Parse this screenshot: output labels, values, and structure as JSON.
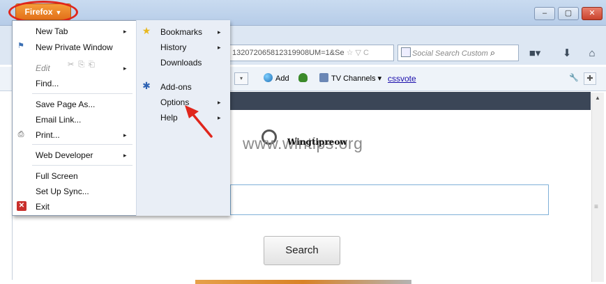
{
  "window": {
    "menu_button": "Firefox",
    "controls": {
      "minimize": "–",
      "maximize": "▢",
      "close": "✕"
    }
  },
  "navbar": {
    "url_fragment": "132072065812319908UM=1&Se",
    "url_icons": "☆ ▽ C",
    "search_placeholder": "Social Search Custom",
    "search_icon_glyph": "⌕",
    "toolbar_icons": [
      "■▾",
      "⬇",
      "⌂"
    ]
  },
  "bookmarks_bar": {
    "dropdown": "▾",
    "add": "Add",
    "tv_channels": "TV Channels ▾",
    "cssvote": "cssvote",
    "right_tools": [
      "🔧",
      "✚"
    ]
  },
  "content": {
    "logo_text": "www.wintips.org",
    "logo_overlay": "Wingtipreow",
    "search_button": "Search"
  },
  "menu": {
    "left": [
      {
        "label": "New Tab",
        "submenu": true
      },
      {
        "label": "New Private Window",
        "submenu": false
      },
      {
        "label": "Edit",
        "submenu": true
      },
      {
        "label": "Find...",
        "submenu": false
      },
      {
        "label": "Save Page As...",
        "submenu": false
      },
      {
        "label": "Email Link...",
        "submenu": false
      },
      {
        "label": "Print...",
        "submenu": true
      },
      {
        "label": "Web Developer",
        "submenu": true
      },
      {
        "label": "Full Screen",
        "submenu": false
      },
      {
        "label": "Set Up Sync...",
        "submenu": false
      },
      {
        "label": "Exit",
        "submenu": false
      }
    ],
    "right": [
      {
        "label": "Bookmarks",
        "submenu": true
      },
      {
        "label": "History",
        "submenu": true
      },
      {
        "label": "Downloads",
        "submenu": false
      },
      {
        "label": "Add-ons",
        "submenu": false
      },
      {
        "label": "Options",
        "submenu": true
      },
      {
        "label": "Help",
        "submenu": true
      }
    ],
    "submenu_glyph": "▸",
    "icons": {
      "bookmarks": "★",
      "private": "⚑",
      "print": "⎙",
      "addons": "✱",
      "exit": "✕",
      "edit_tools": "✂⎘⎗"
    }
  },
  "colors": {
    "firefox_button": "#e2701a",
    "annotation_red": "#e0261c",
    "content_bar": "#3b4657"
  }
}
